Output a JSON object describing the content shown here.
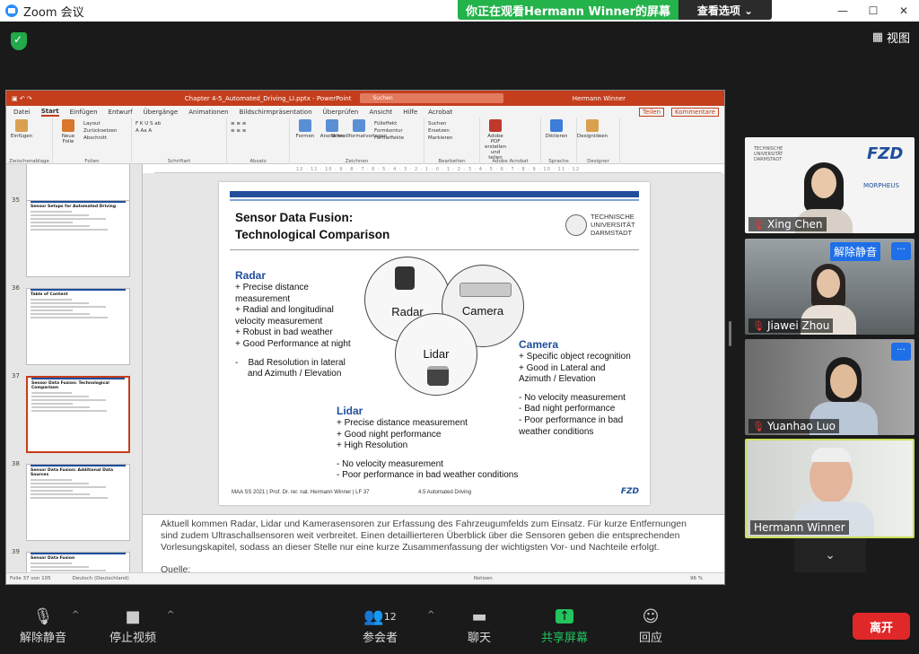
{
  "window": {
    "title": "Zoom 会议"
  },
  "banner": {
    "message": "你正在观看Hermann  Winner的屏幕",
    "options_label": "查看选项 ⌄"
  },
  "view_label": "视图",
  "ppt": {
    "filename": "Chapter 4-5_Automated_Driving_LI.pptx  -  PowerPoint",
    "search": "Suchen",
    "user": "Hermann Winner",
    "menu": [
      "Datei",
      "Start",
      "Einfügen",
      "Entwurf",
      "Übergänge",
      "Animationen",
      "Bildschirmpräsentation",
      "Überprüfen",
      "Ansicht",
      "Hilfe",
      "Acrobat"
    ],
    "menu_right": [
      "Teilen",
      "Kommentare"
    ],
    "ribbon": [
      {
        "label": "Zwischenablage",
        "buttons": [
          "Einfügen"
        ]
      },
      {
        "label": "Folien",
        "buttons": [
          "Neue Folie"
        ],
        "small": [
          "Layout",
          "Zurücksetzen",
          "Abschnitt"
        ]
      },
      {
        "label": "Schriftart",
        "buttons": [],
        "small": [
          "F  K  U  S  ab",
          "A  Aa  A"
        ]
      },
      {
        "label": "Absatz",
        "buttons": [],
        "small": [
          "≡  ≡  ≡",
          "≡  ≡  ≡"
        ]
      },
      {
        "label": "Zeichnen",
        "buttons": [
          "Formen",
          "Anordnen",
          "Schnellformatvorlagen"
        ],
        "small": [
          "Fülleffekt",
          "Formkontur",
          "Formeffekte"
        ]
      },
      {
        "label": "Bearbeiten",
        "buttons": [],
        "small": [
          "Suchen",
          "Ersetzen",
          "Markieren"
        ]
      },
      {
        "label": "Adobe Acrobat",
        "buttons": [
          "Adobe PDF erstellen und teilen"
        ]
      },
      {
        "label": "Sprache",
        "buttons": [
          "Diktieren"
        ]
      },
      {
        "label": "Designer",
        "buttons": [
          "Designideen"
        ]
      }
    ],
    "ruler": "12 · 11 · 10 · 9 · 8 · 7 · 6 · 5 · 4 · 3 · 2 · 1 · 0 · 1 · 2 · 3 · 4 · 5 · 6 · 7 · 8 · 9 · 10 · 11 · 12",
    "thumbs": [
      {
        "num": "35",
        "title": "Sensor Setups for Automated Driving"
      },
      {
        "num": "36",
        "title": "Table of Content"
      },
      {
        "num": "37",
        "title": "Sensor Data Fusion: Technological Comparison",
        "selected": true
      },
      {
        "num": "38",
        "title": "Sensor Data Fusion: Additional Data Sources"
      },
      {
        "num": "39",
        "title": "Sensor Data Fusion"
      }
    ],
    "slide": {
      "title_line1": "Sensor Data Fusion:",
      "title_line2": "Technological Comparison",
      "logo_lines": [
        "TECHNISCHE",
        "UNIVERSITÄT",
        "DARMSTADT"
      ],
      "radar": {
        "heading": "Radar",
        "pros": [
          "+ Precise distance",
          "measurement",
          "+ Radial and longitudinal",
          "velocity measurement",
          "+ Robust in bad weather",
          "+ Good Performance at night"
        ],
        "cons": [
          "-    Bad Resolution in lateral",
          "     and Azimuth / Elevation"
        ]
      },
      "lidar": {
        "heading": "Lidar",
        "pros": [
          "+ Precise distance measurement",
          "+ Good night performance",
          "+ High Resolution"
        ],
        "cons": [
          "- No velocity measurement",
          "- Poor performance in bad weather conditions"
        ]
      },
      "camera": {
        "heading": "Camera",
        "pros": [
          "+ Specific object recognition",
          "+ Good in Lateral and",
          "Azimuth / Elevation"
        ],
        "cons": [
          "- No velocity measurement",
          "- Bad night performance",
          "- Poor performance in bad",
          "weather conditions"
        ]
      },
      "circles": {
        "radar": "Radar",
        "camera": "Camera",
        "lidar": "Lidar"
      },
      "footer_left": "MAA SS 2021 | Prof. Dr. rer. nat. Hermann Winner | LF 37",
      "footer_mid": "4.5 Automated Driving",
      "footer_logo": "FZD"
    },
    "notes": "Aktuell kommen Radar, Lidar und Kamerasensoren zur Erfassung des Fahrzeugumfelds zum Einsatz. Für kurze Entfernungen sind zudem Ultraschallsensoren weit verbreitet. Einen detaillierteren Überblick über die Sensoren geben die entsprechenden Vorlesungskapitel, sodass an dieser Stelle nur eine kurze Zusammenfassung der wichtigsten Vor- und Nachteile erfolgt.",
    "notes_source": "Quelle:",
    "status": {
      "slide": "Folie 37 von 105",
      "lang": "Deutsch (Deutschland)",
      "notes": "Notizen",
      "zoom": "96 %"
    }
  },
  "participants": [
    {
      "name": "Xing Chen",
      "logo1": "TECHNISCHE UNIVERSITÄT DARMSTADT",
      "logo2": "FZD",
      "logo3": "MORPHEUS"
    },
    {
      "name": "Jiawei Zhou",
      "unmute": "解除静音",
      "more": "···"
    },
    {
      "name": "Yuanhao Luo",
      "more": "···"
    },
    {
      "name": "Hermann Winner",
      "active": true
    }
  ],
  "toolbar": {
    "unmute": "解除静音",
    "video": "停止视频",
    "participants": "参会者",
    "participants_count": "12",
    "chat": "聊天",
    "share": "共享屏幕",
    "react": "回应",
    "leave": "离开"
  },
  "colors": {
    "accent": "#2d8cff",
    "share_green": "#24b24b",
    "ppt_red": "#c43e1c",
    "slide_blue": "#1f4e9b",
    "leave_red": "#e02828"
  }
}
